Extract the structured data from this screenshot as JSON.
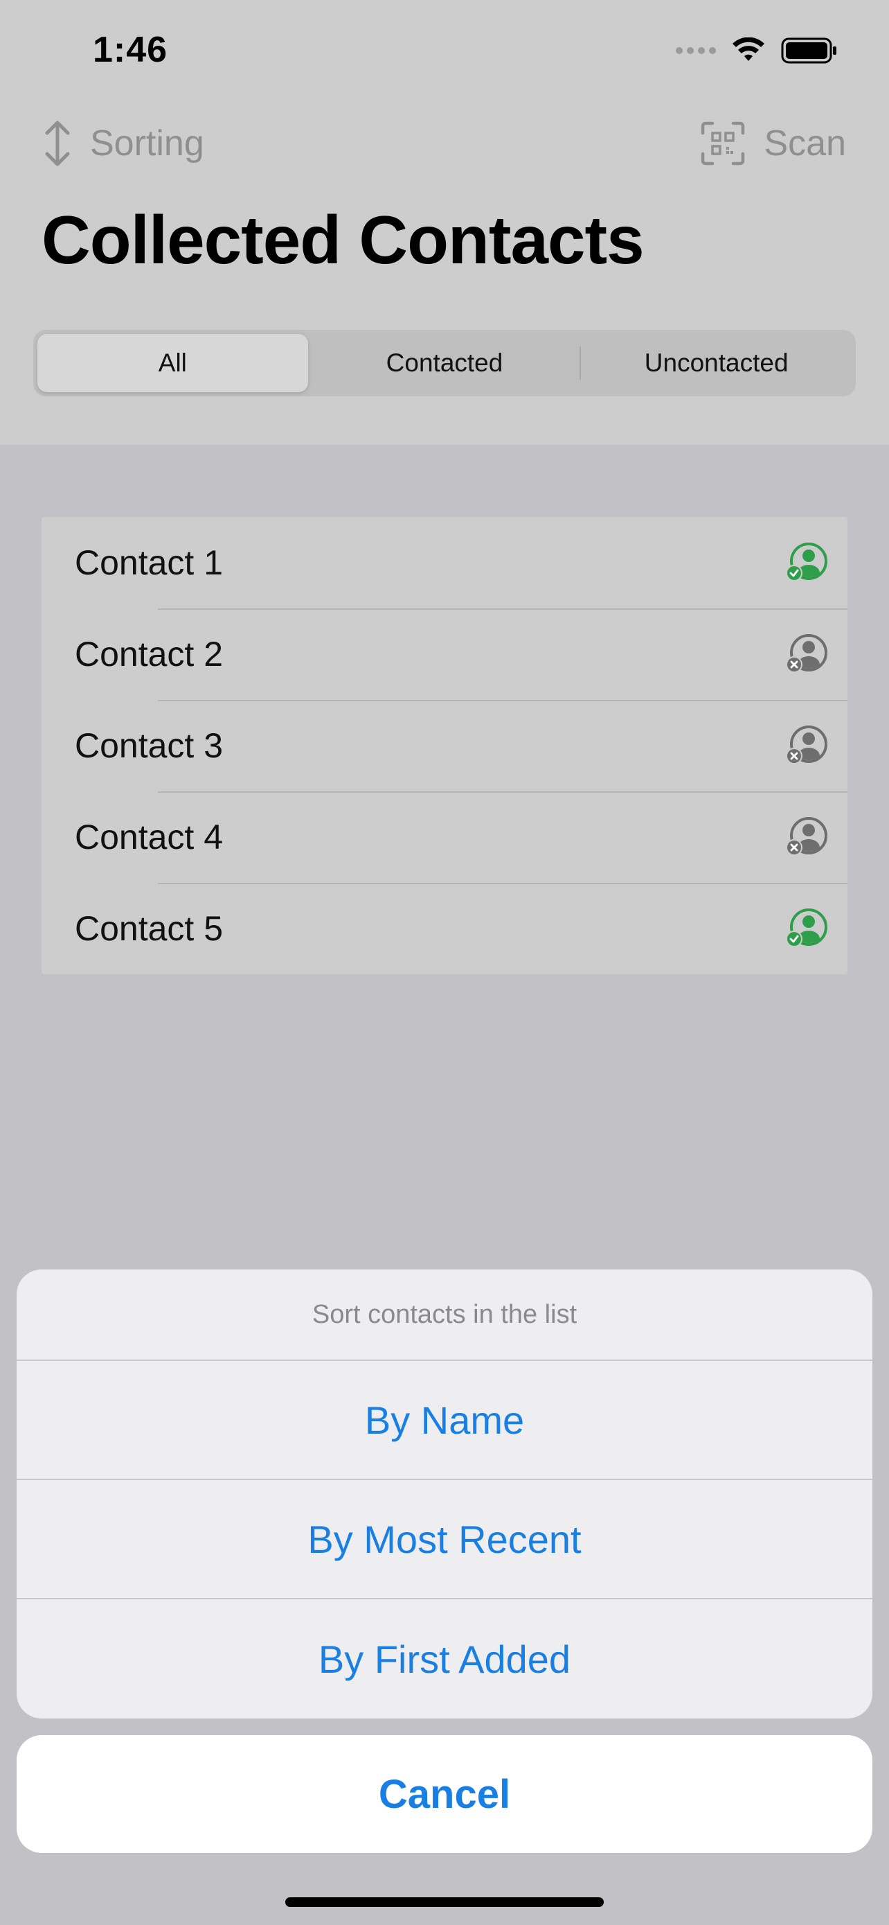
{
  "status_bar": {
    "time": "1:46"
  },
  "nav": {
    "left_label": "Sorting",
    "right_label": "Scan"
  },
  "page_title": "Collected Contacts",
  "segments": [
    {
      "label": "All",
      "selected": true
    },
    {
      "label": "Contacted",
      "selected": false
    },
    {
      "label": "Uncontacted",
      "selected": false
    }
  ],
  "contacts": [
    {
      "name": "Contact 1",
      "status": "contacted"
    },
    {
      "name": "Contact 2",
      "status": "uncontacted"
    },
    {
      "name": "Contact 3",
      "status": "uncontacted"
    },
    {
      "name": "Contact 4",
      "status": "uncontacted"
    },
    {
      "name": "Contact 5",
      "status": "contacted"
    }
  ],
  "action_sheet": {
    "title": "Sort contacts in the list",
    "options": [
      "By Name",
      "By Most Recent",
      "By First Added"
    ],
    "cancel_label": "Cancel"
  },
  "colors": {
    "accent": "#1a7fe3",
    "contacted": "#2e9e4b",
    "uncontacted": "#6e6e6e"
  }
}
